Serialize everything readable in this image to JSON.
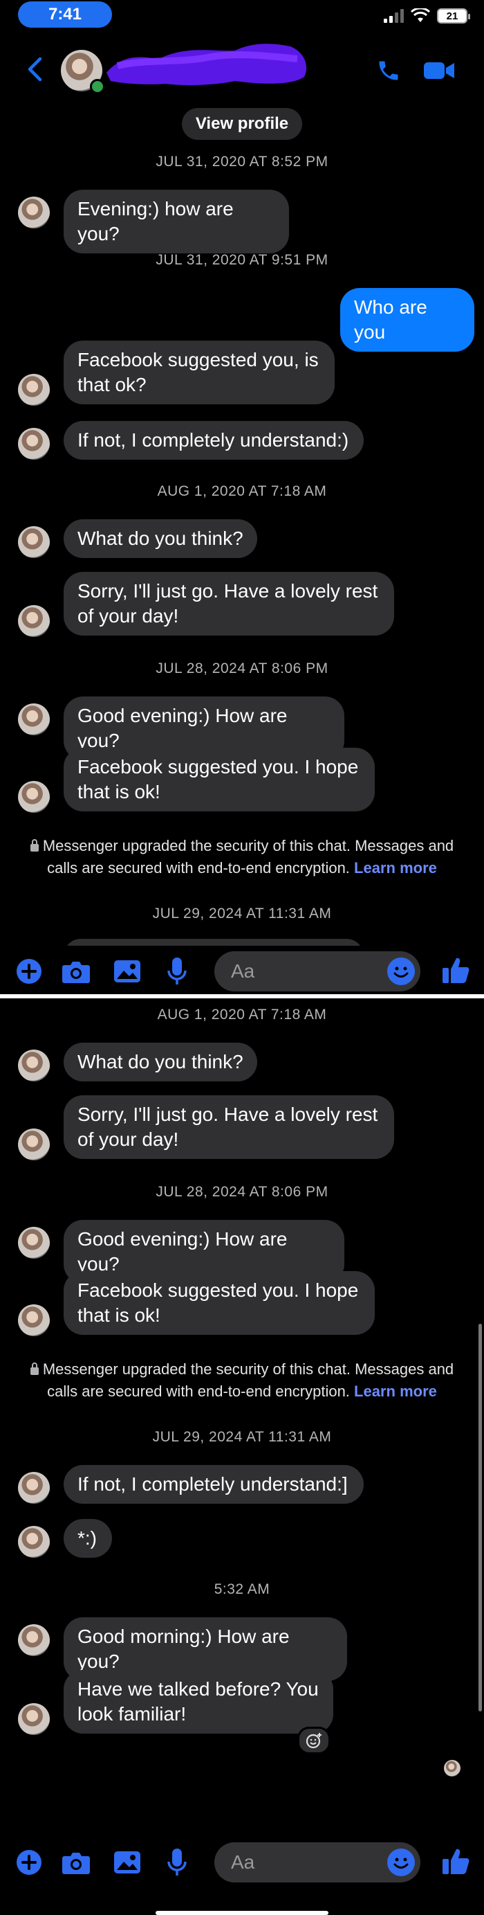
{
  "status": {
    "time": "7:41",
    "battery": "21"
  },
  "header": {
    "view_profile": "View profile"
  },
  "screen1": {
    "timestamps": [
      "JUL 31, 2020 AT 8:52 PM",
      "JUL 31, 2020 AT 9:51 PM",
      "AUG 1, 2020 AT 7:18 AM",
      "JUL 28, 2024 AT 8:06 PM",
      "JUL 29, 2024 AT 11:31 AM"
    ],
    "messages": [
      {
        "text": "Evening:) how are you?",
        "direction": "incoming"
      },
      {
        "text": "Who are you",
        "direction": "outgoing"
      },
      {
        "text": "Facebook suggested you, is that ok?",
        "direction": "incoming"
      },
      {
        "text": "If not, I completely understand:)",
        "direction": "incoming"
      },
      {
        "text": "What do you think?",
        "direction": "incoming"
      },
      {
        "text": "Sorry, I'll just go. Have a lovely rest of your day!",
        "direction": "incoming"
      },
      {
        "text": "Good evening:) How are you?",
        "direction": "incoming"
      },
      {
        "text": "Facebook suggested you. I hope that is ok!",
        "direction": "incoming"
      }
    ],
    "security_note": "Messenger upgraded the security of this chat. Messages and calls are secured with end-to-end encryption.",
    "learn_more": "Learn more"
  },
  "screen2": {
    "timestamps": [
      "AUG 1, 2020 AT 7:18 AM",
      "JUL 28, 2024 AT 8:06 PM",
      "JUL 29, 2024 AT 11:31 AM",
      "5:32 AM"
    ],
    "messages": [
      {
        "text": "What do you think?",
        "direction": "incoming"
      },
      {
        "text": "Sorry, I'll just go. Have a lovely rest of your day!",
        "direction": "incoming"
      },
      {
        "text": "Good evening:) How are you?",
        "direction": "incoming"
      },
      {
        "text": "Facebook suggested you. I hope that is ok!",
        "direction": "incoming"
      },
      {
        "text": "If not, I completely understand:]",
        "direction": "incoming"
      },
      {
        "text": "*:)",
        "direction": "incoming"
      },
      {
        "text": "Good morning:) How are you?",
        "direction": "incoming"
      },
      {
        "text": "Have we talked before? You look familiar!",
        "direction": "incoming"
      }
    ],
    "security_note": "Messenger upgraded the security of this chat. Messages and calls are secured with end-to-end encryption.",
    "learn_more": "Learn more"
  },
  "composer": {
    "placeholder": "Aa"
  },
  "icons": [
    "back-chevron-icon",
    "phone-icon",
    "video-icon",
    "plus-icon",
    "camera-icon",
    "gallery-icon",
    "microphone-icon",
    "emoji-icon",
    "thumbs-up-icon",
    "add-reaction-icon"
  ],
  "colors": {
    "accent": "#0a7cff",
    "incoming_bubble": "#303032",
    "background": "#000000",
    "link": "#6c8cff"
  }
}
